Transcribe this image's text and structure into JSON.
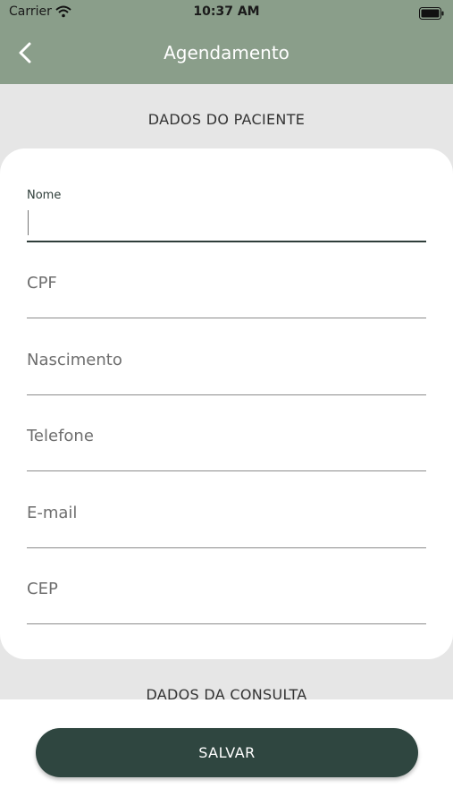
{
  "status_bar": {
    "carrier": "Carrier",
    "time": "10:37 AM"
  },
  "header": {
    "title": "Agendamento",
    "back_icon": "chevron-left-icon"
  },
  "sections": {
    "patient_title": "DADOS DO PACIENTE",
    "consult_title": "DADOS DA CONSULTA"
  },
  "form": {
    "fields": [
      {
        "label": "Nome",
        "value": ""
      },
      {
        "label": "CPF",
        "value": ""
      },
      {
        "label": "Nascimento",
        "value": ""
      },
      {
        "label": "Telefone",
        "value": ""
      },
      {
        "label": "E-mail",
        "value": ""
      },
      {
        "label": "CEP",
        "value": ""
      }
    ]
  },
  "actions": {
    "save_label": "SALVAR"
  },
  "colors": {
    "header_bg": "#8a9e8a",
    "button_bg": "#2f4640",
    "page_bg": "#e6e6e6"
  }
}
